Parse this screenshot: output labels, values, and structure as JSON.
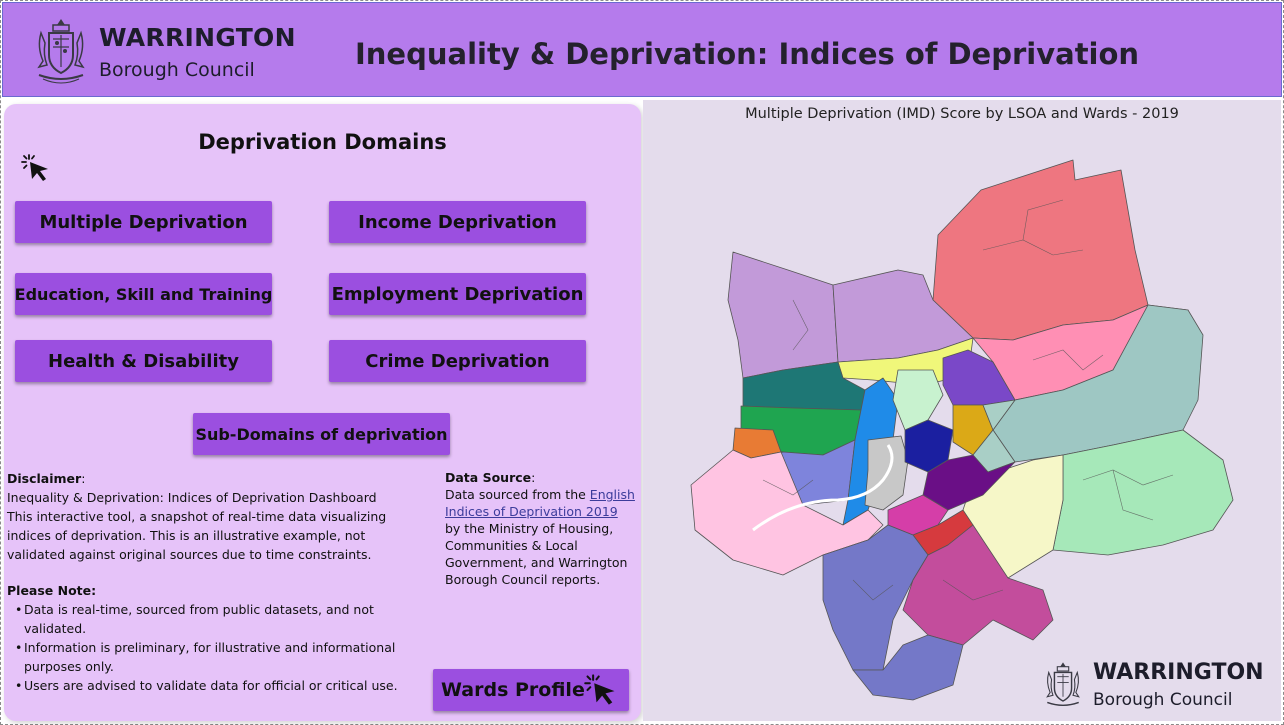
{
  "header": {
    "brand_name": "WARRINGTON",
    "brand_sub": "Borough Council",
    "title": "Inequality & Deprivation: Indices of Deprivation",
    "bg_color": "#b57bec",
    "crest_icon": "coat-of-arms-icon"
  },
  "domains": {
    "title": "Deprivation Domains",
    "pointer_icon": "click-pointer-icon",
    "buttons": [
      {
        "label": "Multiple Deprivation"
      },
      {
        "label": "Income Deprivation"
      },
      {
        "label": "Education, Skill and Training"
      },
      {
        "label": "Employment Deprivation"
      },
      {
        "label": "Health & Disability"
      },
      {
        "label": "Crime Deprivation"
      }
    ],
    "subdomains_label": "Sub-Domains of deprivation",
    "button_color": "#9b4fe0",
    "panel_color": "#e6c3f9"
  },
  "disclaimer": {
    "heading": "Disclaimer",
    "colon": ":",
    "line1": "Inequality & Deprivation: Indices of Deprivation Dashboard",
    "line2": "This interactive tool, a snapshot of real-time data visualizing indices of deprivation. This is an illustrative example, not validated against original sources due to time constraints."
  },
  "note": {
    "heading": "Please Note:",
    "items": [
      "Data is real-time, sourced from public datasets, and not validated.",
      "Information is preliminary, for illustrative and informational purposes only.",
      "Users are advised to validate data for official or critical use."
    ]
  },
  "source": {
    "heading": "Data Source",
    "colon": ":",
    "prefix": "Data sourced from the ",
    "link": "English Indices of Deprivation 2019",
    "suffix": " by the Ministry of Housing, Communities & Local Government, and Warrington Borough Council reports."
  },
  "wards_button": {
    "label": "Wards Profile",
    "icon": "click-pointer-icon"
  },
  "map": {
    "title": "Multiple Deprivation (IMD) Score by LSOA and Wards - 2019",
    "brand_name": "WARRINGTON",
    "brand_sub": "Borough Council",
    "bg_color": "#e4dcec"
  }
}
